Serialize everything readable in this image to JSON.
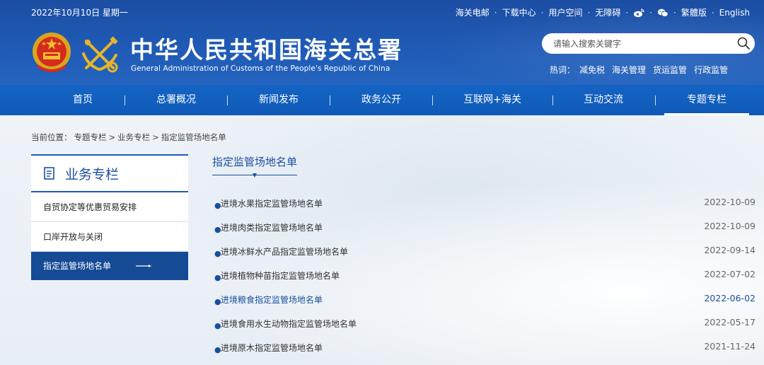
{
  "header": {
    "date": "2022年10月10日 星期一",
    "toplinks": [
      "海关电邮",
      "下载中心",
      "用户空间",
      "无障碍"
    ],
    "lang_links": [
      "繁體版",
      "English"
    ],
    "site_name": "中华人民共和国海关总署",
    "site_name_en": "General Administration of Customs of the People's Republic of China",
    "search_placeholder": "请输入搜索关键字",
    "hot_label": "热词：",
    "hot_words": [
      "减免税",
      "海关管理",
      "货运监管",
      "行政监管"
    ]
  },
  "nav": {
    "items": [
      "首页",
      "总署概况",
      "新闻发布",
      "政务公开",
      "互联网+海关",
      "互动交流",
      "专题专栏"
    ],
    "active_index": 6
  },
  "breadcrumb": {
    "prefix": "当前位置：",
    "items": [
      "专题专栏",
      "业务专栏",
      "指定监管场地名单"
    ],
    "separator": ">"
  },
  "sidebar": {
    "title": "业务专栏",
    "items": [
      "自贸协定等优惠贸易安排",
      "口岸开放与关闭",
      "指定监管场地名单"
    ],
    "active_index": 2
  },
  "main": {
    "title": "指定监管场地名单",
    "list": [
      {
        "title": "进境水果指定监管场地名单",
        "date": "2022-10-09"
      },
      {
        "title": "进境肉类指定监管场地名单",
        "date": "2022-10-09"
      },
      {
        "title": "进境冰鲜水产品指定监管场地名单",
        "date": "2022-09-14"
      },
      {
        "title": "进境植物种苗指定监管场地名单",
        "date": "2022-07-02"
      },
      {
        "title": "进境粮食指定监管场地名单",
        "date": "2022-06-02"
      },
      {
        "title": "进境食用水生动物指定监管场地名单",
        "date": "2022-05-17"
      },
      {
        "title": "进境原木指定监管场地名单",
        "date": "2021-11-24"
      }
    ],
    "highlight_index": 4
  },
  "colors": {
    "header_blue": "#1f5ab5",
    "nav_blue": "#1463c4",
    "sidebar_active": "#154a95",
    "link_blue": "#1b4f9e"
  }
}
